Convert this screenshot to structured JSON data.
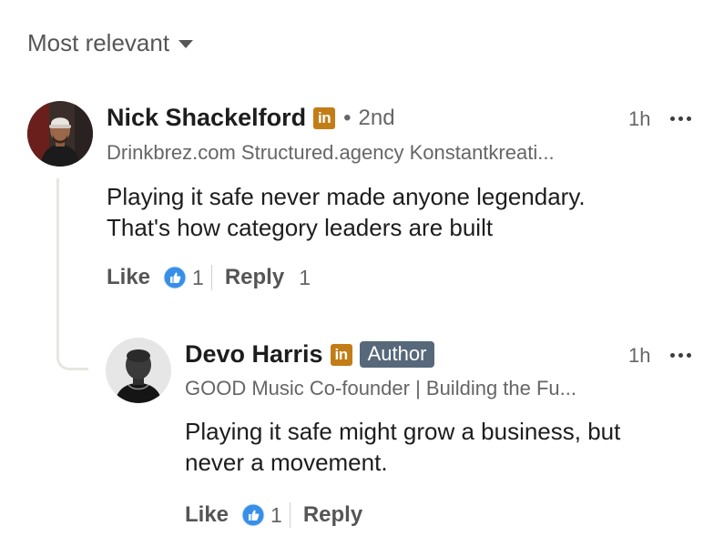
{
  "sort": {
    "label": "Most relevant"
  },
  "comment": {
    "name": "Nick Shackelford",
    "linkedin_badge": "in",
    "separator": "•",
    "degree": "2nd",
    "time": "1h",
    "headline": "Drinkbrez.com Structured.agency Konstantkreati...",
    "text_lines": [
      "Playing it safe never made anyone legendary.",
      "That's how category leaders are built"
    ],
    "like_label": "Like",
    "reaction_count": "1",
    "reply_label": "Reply",
    "reply_count": "1"
  },
  "reply": {
    "name": "Devo Harris",
    "linkedin_badge": "in",
    "author_badge": "Author",
    "time": "1h",
    "headline": "GOOD Music Co-founder | Building the Fu...",
    "text_lines": [
      "Playing it safe might grow a business, but",
      "never a movement."
    ],
    "like_label": "Like",
    "reaction_count": "1",
    "reply_label": "Reply"
  },
  "colors": {
    "linkedin_badge": "#c37d16",
    "author_badge": "#56687a",
    "like_icon": "#378fe9",
    "text_primary": "#1d1d1d",
    "text_secondary": "#666666"
  },
  "icons": {
    "sort_caret": "caret-down-icon",
    "more": "more-horizontal-icon",
    "reaction": "thumbs-up-reaction-icon"
  }
}
